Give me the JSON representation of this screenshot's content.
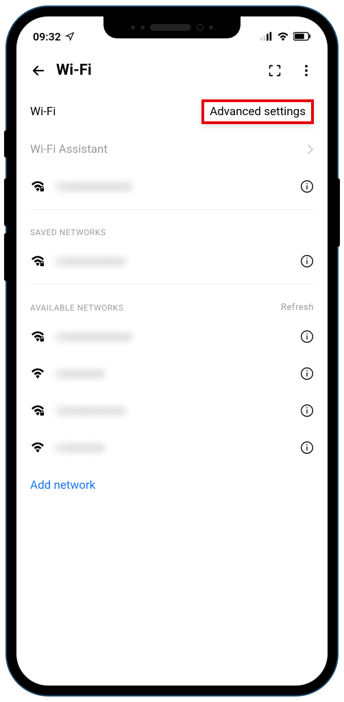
{
  "status": {
    "time": "09:32"
  },
  "title": "Wi-Fi",
  "wifi": {
    "label": "Wi-Fi",
    "advanced_settings": "Advanced settings",
    "assistant_label": "Wi-Fi Assistant"
  },
  "connected": {
    "name": "CXXXXXXXXXX"
  },
  "saved_header": "SAVED NETWORKS",
  "saved": [
    {
      "name": "CXXXXXXXXX"
    }
  ],
  "available_header": "AVAILABLE NETWORKS",
  "refresh_label": "Refresh",
  "available": [
    {
      "name": "CXXXXXXXXXX",
      "locked": true
    },
    {
      "name": "CXXXXXX",
      "locked": false
    },
    {
      "name": "CXXXXXXXXX",
      "locked": true
    },
    {
      "name": "CXXXXXX",
      "locked": false
    }
  ],
  "add_network_label": "Add network"
}
